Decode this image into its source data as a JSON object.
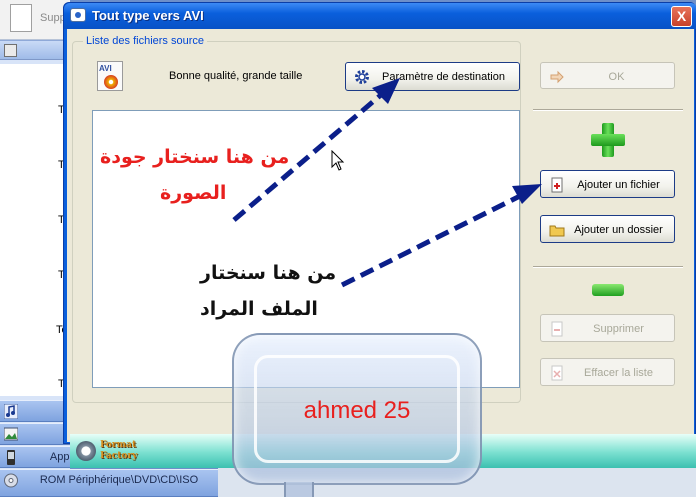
{
  "background_app": {
    "top_label": "Supp",
    "list_letters": [
      "T",
      "T",
      "T",
      "T",
      "T",
      "Te",
      "T"
    ],
    "categories": [
      {
        "label": "",
        "icon": "music-note-icon"
      },
      {
        "label": "",
        "icon": "picture-icon"
      },
      {
        "label": "Appareil Mobile\\PSP\\iPhone",
        "icon": "mobile-device-icon"
      },
      {
        "label": "ROM Périphérique\\DVD\\CD\\ISO",
        "icon": "disc-icon"
      }
    ]
  },
  "dialog": {
    "title": "Tout type vers AVI",
    "close_label": "X",
    "group_label": "Liste des fichiers source",
    "quality_text": "Bonne qualité, grande taille",
    "dest_button": "Paramètre de destination",
    "ok_button": "OK",
    "add_file_button": "Ajouter un fichier",
    "add_folder_button": "Ajouter un dossier",
    "delete_button": "Supprimer",
    "clear_button": "Effacer la liste",
    "format_icon_tag": "AVI",
    "logo_line1": "Format",
    "logo_line2": "Factory"
  },
  "annotations": {
    "quality_note_line1": "من هنا سنختار جودة",
    "quality_note_line2": "الصورة",
    "file_note_line1": "من هنا سنختار",
    "file_note_line2": "الملف المراد",
    "bubble_text": "ahmed 25"
  },
  "colors": {
    "title_bar": "#0a5fdc",
    "annotation_red": "#e8201e",
    "arrow_blue": "#0b1f8a",
    "add_green": "#1e9a1e"
  }
}
